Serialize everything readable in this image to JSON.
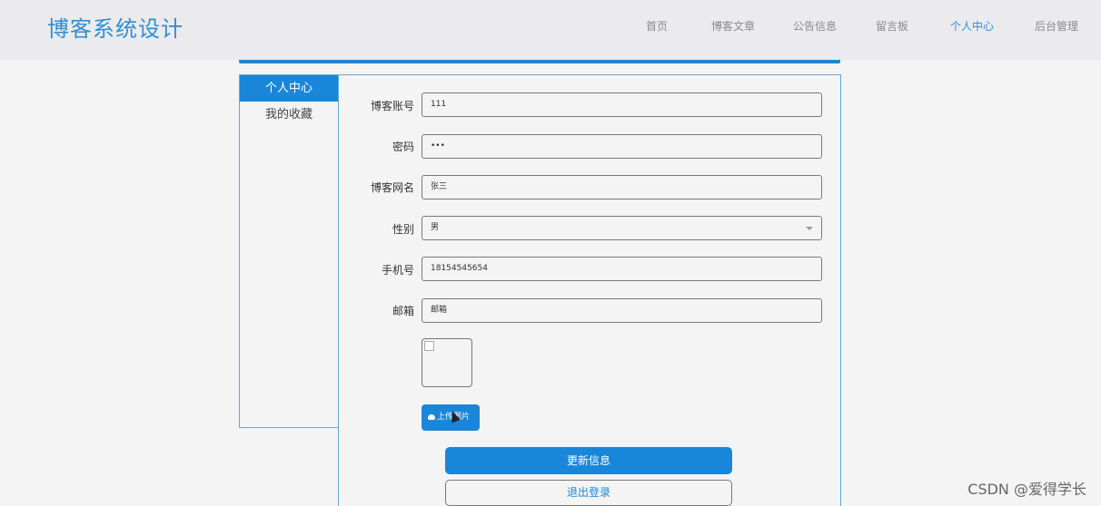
{
  "header": {
    "logo": "博客系统设计",
    "nav": [
      "首页",
      "博客文章",
      "公告信息",
      "留言板",
      "个人中心",
      "后台管理"
    ],
    "active_nav": "个人中心",
    "accent": "#1a86d9"
  },
  "sidebar": {
    "items": [
      "个人中心",
      "我的收藏"
    ]
  },
  "form": {
    "account_label": "博客账号",
    "account_value": "111",
    "password_label": "密码",
    "password_value": "•••",
    "nickname_label": "博客网名",
    "nickname_value": "张三",
    "gender_label": "性别",
    "gender_value": "男",
    "phone_label": "手机号",
    "phone_value": "18154545654",
    "email_label": "邮箱",
    "email_value": "邮箱",
    "upload_label": "上传图片",
    "update_label": "更新信息",
    "logout_label": "退出登录"
  },
  "watermark": "CSDN @爱得学长"
}
